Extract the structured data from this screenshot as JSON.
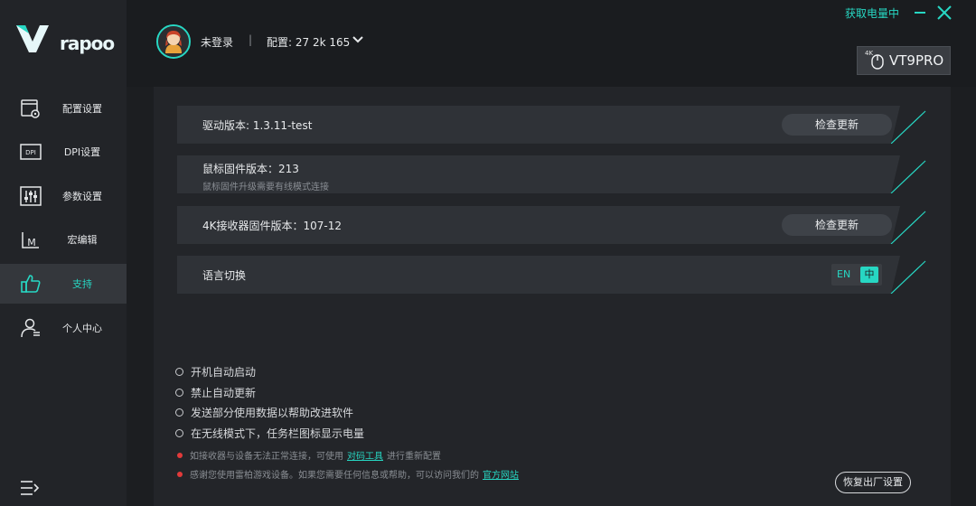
{
  "brand": {
    "name": "rapoo"
  },
  "sidebar": {
    "items": [
      {
        "label": "配置设置",
        "icon": "config-icon"
      },
      {
        "label": "DPI设置",
        "icon": "dpi-icon"
      },
      {
        "label": "参数设置",
        "icon": "sliders-icon"
      },
      {
        "label": "宏编辑",
        "icon": "macro-icon"
      },
      {
        "label": "支持",
        "icon": "thumbs-up-icon",
        "active": true
      },
      {
        "label": "个人中心",
        "icon": "user-icon"
      }
    ],
    "menu_icon": "menu-icon"
  },
  "header": {
    "login_status": "未登录",
    "separator": "|",
    "config": "配置: 27 2k 165",
    "get_power": "获取电量中",
    "device_prefix": "4K",
    "device_name": "VT9PRO"
  },
  "support": {
    "driver": {
      "title": "驱动版本: 1.3.11-test",
      "button": "检查更新"
    },
    "mouse_fw": {
      "title": "鼠标固件版本：213",
      "subtitle": "鼠标固件升级需要有线模式连接"
    },
    "receiver_fw": {
      "title": "4K接收器固件版本：107-12",
      "button": "检查更新"
    },
    "language": {
      "title": "语言切换",
      "en": "EN",
      "zh": "中",
      "selected": "zh"
    }
  },
  "options": [
    {
      "label": "开机自动启动"
    },
    {
      "label": "禁止自动更新"
    },
    {
      "label": "发送部分使用数据以帮助改进软件"
    },
    {
      "label": "在无线模式下，任务栏图标显示电量"
    }
  ],
  "notes": {
    "note1": {
      "before": "如接收器与设备无法正常连接，可使用",
      "link": "对码工具",
      "after": "进行重新配置"
    },
    "note2": {
      "before": "感谢您使用雷柏游戏设备。如果您需要任何信息或帮助，可以访问我们的",
      "link": "官方网站"
    }
  },
  "reset_button": "恢复出厂设置",
  "colors": {
    "accent": "#27d7c3",
    "background": "#1c1e21",
    "sidebar": "#222428",
    "warning_dot": "#e23a3a"
  }
}
